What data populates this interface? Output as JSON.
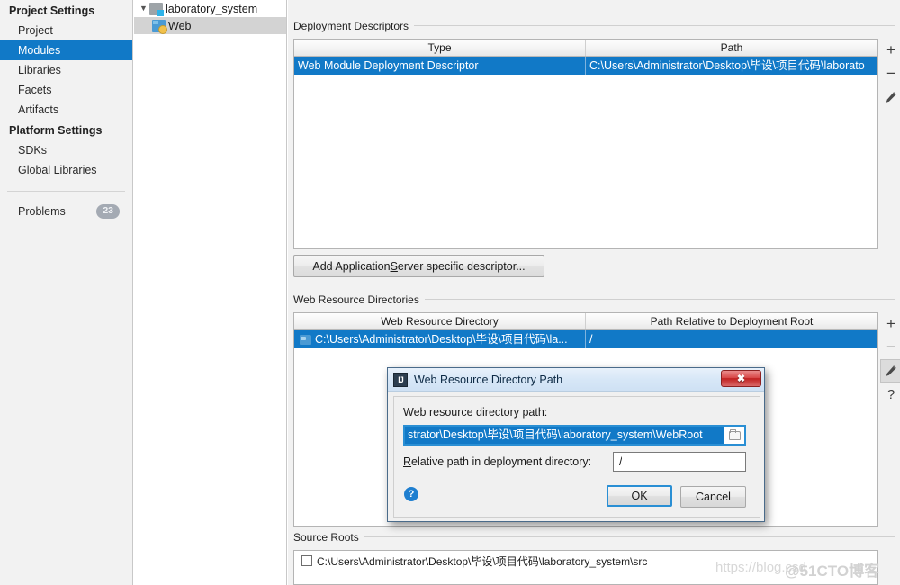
{
  "sidebar": {
    "groups": [
      {
        "label": "Project Settings",
        "items": [
          {
            "label": "Project",
            "selected": false
          },
          {
            "label": "Modules",
            "selected": true
          },
          {
            "label": "Libraries",
            "selected": false
          },
          {
            "label": "Facets",
            "selected": false
          },
          {
            "label": "Artifacts",
            "selected": false
          }
        ]
      },
      {
        "label": "Platform Settings",
        "items": [
          {
            "label": "SDKs",
            "selected": false
          },
          {
            "label": "Global Libraries",
            "selected": false
          }
        ]
      }
    ],
    "problems": {
      "label": "Problems",
      "count": "23"
    }
  },
  "tree": {
    "nodes": [
      {
        "label": "laboratory_system",
        "icon": "module-icon",
        "expanded": true,
        "selected": false
      },
      {
        "label": "Web",
        "icon": "web-facet-icon",
        "selected": true
      }
    ]
  },
  "main": {
    "deployment_descriptors": {
      "title": "Deployment Descriptors",
      "columns": [
        "Type",
        "Path"
      ],
      "rows": [
        {
          "type": "Web Module Deployment Descriptor",
          "path": "C:\\Users\\Administrator\\Desktop\\毕设\\项目代码\\laborato",
          "selected": true
        }
      ],
      "toolbar": [
        {
          "name": "add-descriptor-button",
          "glyph": "+"
        },
        {
          "name": "remove-descriptor-button",
          "glyph": "−"
        },
        {
          "name": "edit-descriptor-button",
          "glyph": "pencil"
        }
      ]
    },
    "add_app_server_button": {
      "prefix": "Add Application ",
      "mnemonic": "S",
      "suffix": "erver specific descriptor..."
    },
    "web_resource_directories": {
      "title": "Web Resource Directories",
      "columns": [
        "Web Resource Directory",
        "Path Relative to Deployment Root"
      ],
      "rows": [
        {
          "directory": "C:\\Users\\Administrator\\Desktop\\毕设\\项目代码\\la...",
          "relative": "/",
          "selected": true
        }
      ],
      "toolbar": [
        {
          "name": "add-resource-dir-button",
          "glyph": "+"
        },
        {
          "name": "remove-resource-dir-button",
          "glyph": "−"
        },
        {
          "name": "edit-resource-dir-button",
          "glyph": "pencil",
          "active": true
        },
        {
          "name": "help-resource-dir-button",
          "glyph": "?"
        }
      ]
    },
    "source_roots": {
      "title": "Source Roots",
      "rows": [
        {
          "path": "C:\\Users\\Administrator\\Desktop\\毕设\\项目代码\\laboratory_system\\src",
          "checked": false
        }
      ]
    }
  },
  "dialog": {
    "title": "Web Resource Directory Path",
    "app_icon": "IJ",
    "close_glyph": "✖",
    "path_label": "Web resource directory path:",
    "path_value": "strator\\Desktop\\毕设\\项目代码\\laboratory_system\\WebRoot",
    "relative_label_prefix": "R",
    "relative_label_rest": "elative path in deployment directory:",
    "relative_value": "/",
    "help_glyph": "?",
    "ok_label": "OK",
    "cancel_label": "Cancel"
  },
  "watermarks": {
    "url": "https://blog.csd",
    "brand": "@51CTO博客"
  },
  "colors": {
    "selection_blue": "#1179c7",
    "sidebar_bg": "#f2f2f2",
    "panel_bg": "#f2f2f2",
    "dialog_title": "#d7e7f7",
    "close_red": "#c02020"
  }
}
